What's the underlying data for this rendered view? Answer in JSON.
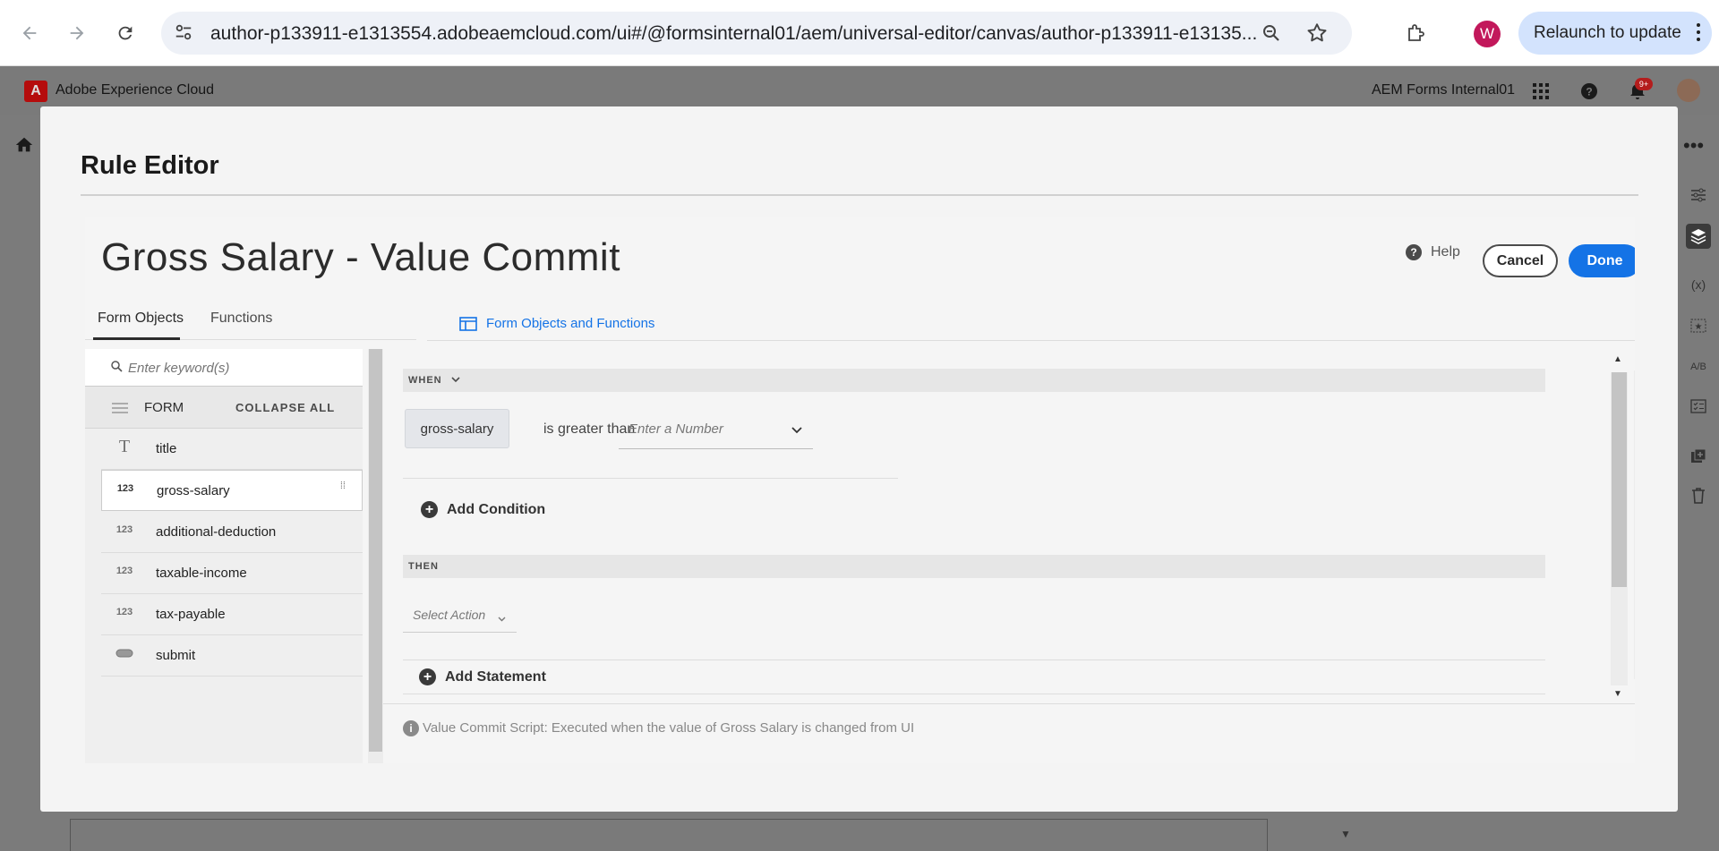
{
  "browser": {
    "url": "author-p133911-e1313554.adobeaemcloud.com/ui#/@formsinternal01/aem/universal-editor/canvas/author-p133911-e13135...",
    "profile_initial": "W",
    "relaunch_label": "Relaunch to update"
  },
  "aem_header": {
    "product": "Adobe Experience Cloud",
    "org": "AEM Forms Internal01",
    "notification_count": "9+"
  },
  "modal": {
    "title": "Rule Editor"
  },
  "editor": {
    "rule_title": "Gross Salary - Value Commit",
    "help_label": "Help",
    "cancel_label": "Cancel",
    "done_label": "Done",
    "tabs": [
      {
        "label": "Form Objects",
        "active": true
      },
      {
        "label": "Functions",
        "active": false
      }
    ],
    "form_objects_link": "Form Objects and Functions",
    "search_placeholder": "Enter keyword(s)",
    "form_label": "FORM",
    "collapse_all": "COLLAPSE ALL",
    "tree": [
      {
        "icon": "T",
        "label": "title"
      },
      {
        "icon": "123",
        "label": "gross-salary",
        "selected": true
      },
      {
        "icon": "123",
        "label": "additional-deduction"
      },
      {
        "icon": "123",
        "label": "taxable-income"
      },
      {
        "icon": "123",
        "label": "tax-payable"
      },
      {
        "icon": "button-icon",
        "label": "submit"
      }
    ],
    "when_label": "WHEN",
    "condition": {
      "field": "gross-salary",
      "operator": "is greater than",
      "value_placeholder": "Enter a Number"
    },
    "add_condition": "Add Condition",
    "then_label": "THEN",
    "action_placeholder": "Select Action",
    "add_statement": "Add Statement",
    "info_text": "Value Commit Script: Executed when the value of Gross Salary is changed from UI"
  },
  "colors": {
    "accent": "#1473e6",
    "adobe_red": "#b50c0c"
  }
}
